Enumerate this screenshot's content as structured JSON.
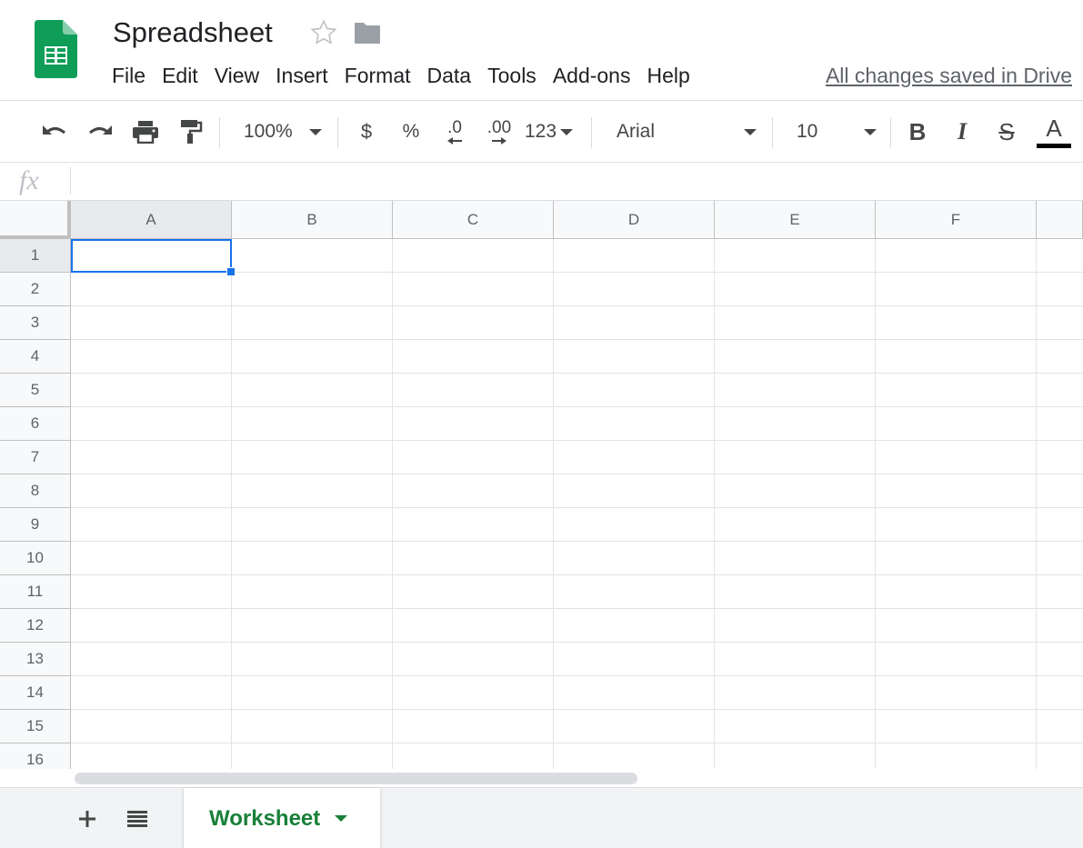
{
  "header": {
    "title": "Spreadsheet",
    "save_status": "All changes saved in Drive",
    "menu": [
      "File",
      "Edit",
      "View",
      "Insert",
      "Format",
      "Data",
      "Tools",
      "Add-ons",
      "Help"
    ]
  },
  "toolbar": {
    "zoom": "100%",
    "currency": "$",
    "percent": "%",
    "decrease_decimal": ".0",
    "increase_decimal": ".00",
    "more_formats": "123",
    "font": "Arial",
    "font_size": "10",
    "bold": "B",
    "italic": "I",
    "strikethrough": "S",
    "text_color": "A"
  },
  "formula_bar": {
    "fx_label": "fx",
    "value": ""
  },
  "grid": {
    "columns": [
      "A",
      "B",
      "C",
      "D",
      "E",
      "F"
    ],
    "rows": [
      "1",
      "2",
      "3",
      "4",
      "5",
      "6",
      "7",
      "8",
      "9",
      "10",
      "11",
      "12",
      "13",
      "14",
      "15",
      "16"
    ],
    "selected_cell": "A1"
  },
  "sheets": {
    "tabs": [
      "Worksheet"
    ],
    "active": "Worksheet"
  },
  "colors": {
    "accent": "#1a73e8",
    "sheet_tab": "#188038",
    "logo": "#0f9d58"
  }
}
